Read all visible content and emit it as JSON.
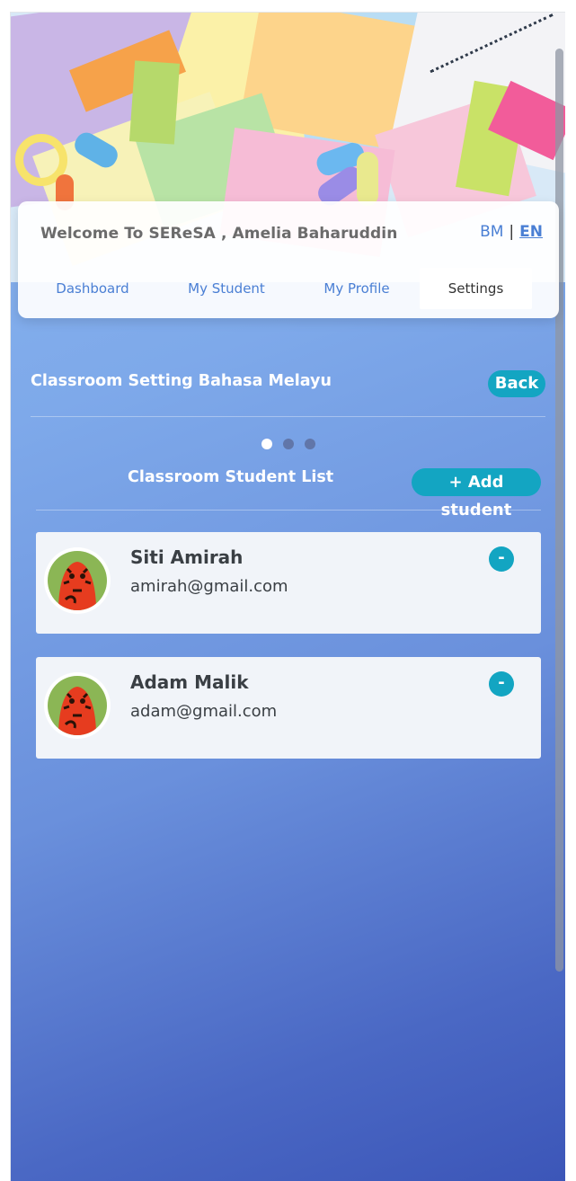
{
  "header": {
    "welcome_text": "Welcome To SEReSA , Amelia Baharuddin",
    "lang_bm": "BM",
    "lang_separator": "|",
    "lang_en": "EN"
  },
  "tabs": [
    {
      "label": "Dashboard",
      "active": false
    },
    {
      "label": "My Student",
      "active": false
    },
    {
      "label": "My Profile",
      "active": false
    },
    {
      "label": "Settings",
      "active": true
    }
  ],
  "page": {
    "section_title": "Classroom Setting Bahasa Melayu",
    "back_label": "Back",
    "carousel_active_index": 0,
    "carousel_count": 3,
    "list_title": "Classroom Student List",
    "add_label": "+ Add student"
  },
  "students": [
    {
      "name": "Siti Amirah",
      "email": "amirah@gmail.com",
      "remove_label": "-"
    },
    {
      "name": "Adam Malik",
      "email": "adam@gmail.com",
      "remove_label": "-"
    }
  ],
  "colors": {
    "accent": "#13a5c2",
    "link": "#4a7fd4",
    "gradient_top": "#8ab6ef",
    "gradient_bottom": "#3c56b8"
  }
}
